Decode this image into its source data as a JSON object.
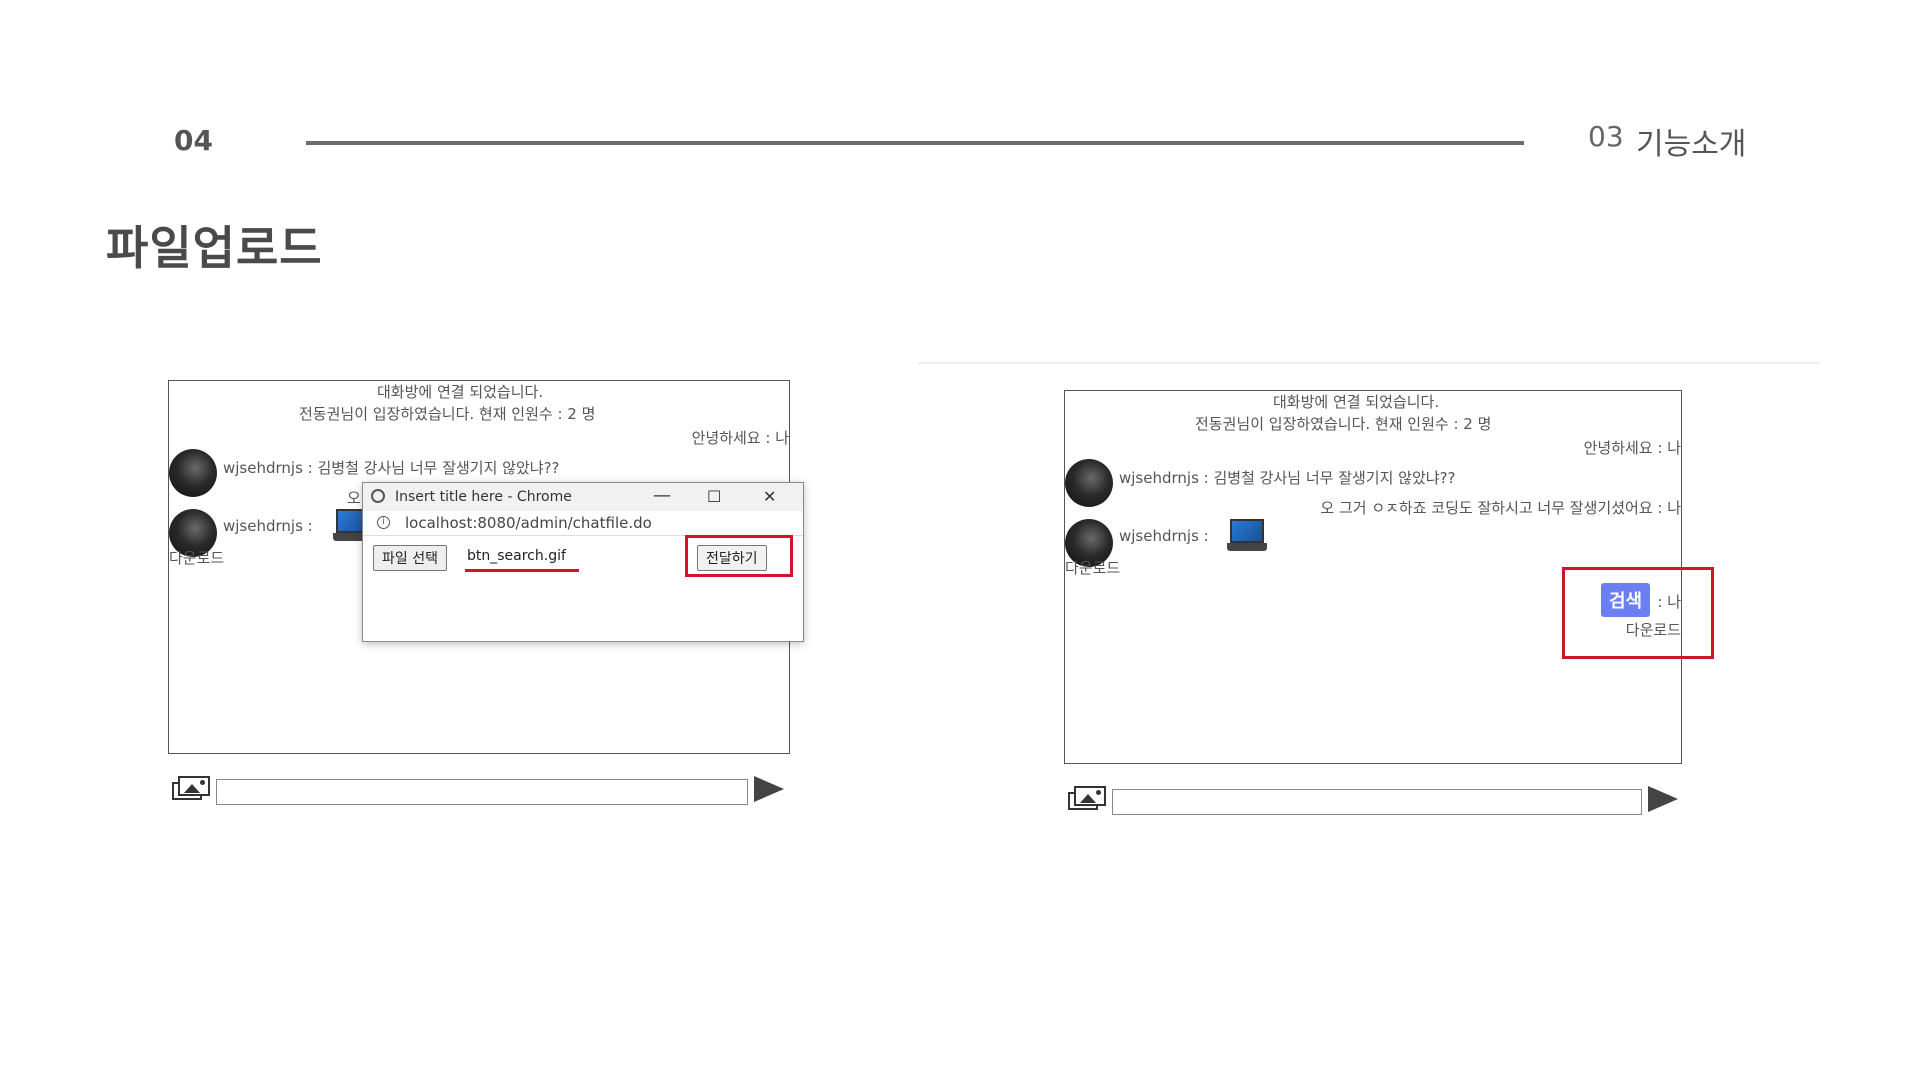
{
  "slide": {
    "page_number": "04",
    "section_number": "03",
    "section_title": "기능소개",
    "title": "파일업로드"
  },
  "left_panel": {
    "system_message_1": "대화방에 연결 되었습니다.",
    "system_message_2": "전동권님이 입장하였습니다. 현재 인원수 : 2 명",
    "my_message_1": "안녕하세요 : 나",
    "user_message_1": "wjsehdrnjs : 김병철 강사님 너무 잘생기지 않았냐??",
    "partial_text": "오",
    "user_message_2_prefix": "wjsehdrnjs :",
    "download_label": "다운로드"
  },
  "popup": {
    "window_title": "Insert title here - Chrome",
    "address": "localhost:8080/admin/chatfile.do",
    "choose_file_label": "파일 선택",
    "selected_file": "btn_search.gif",
    "submit_label": "전달하기",
    "min_symbol": "—",
    "max_symbol": "☐",
    "close_symbol": "✕"
  },
  "right_panel": {
    "system_message_1": "대화방에 연결 되었습니다.",
    "system_message_2": "전동권님이 입장하였습니다. 현재 인원수 : 2 명",
    "my_message_1": "안녕하세요 : 나",
    "user_message_1": "wjsehdrnjs : 김병철 강사님 너무 잘생기지 않았냐??",
    "my_message_2": "오 그거 ㅇㅈ하죠 코딩도 잘하시고 너무 잘생기셨어요 : 나",
    "user_message_2_prefix": "wjsehdrnjs :",
    "download_label_1": "다운로드",
    "search_image_label": "검색",
    "my_file_suffix": ": 나",
    "download_label_2": "다운로드"
  },
  "icons": {
    "image_upload": "image-upload-icon",
    "send": "send-arrow-icon",
    "avatar": "avatar",
    "laptop": "laptop-image"
  },
  "colors": {
    "highlight_red": "#d0142a",
    "search_chip": "#6b7ff2"
  }
}
